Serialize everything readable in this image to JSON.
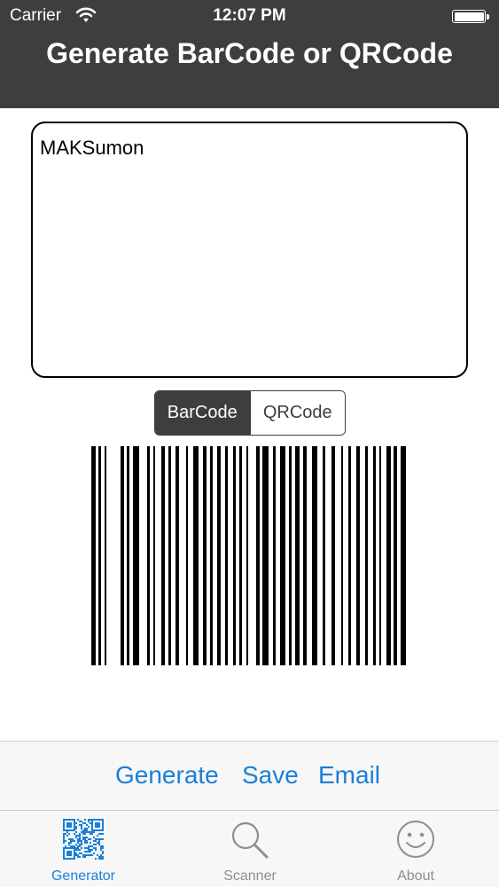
{
  "status_bar": {
    "carrier": "Carrier",
    "time": "12:07 PM"
  },
  "nav": {
    "title": "Generate BarCode or QRCode"
  },
  "input": {
    "value": "MAKSumon"
  },
  "segmented": {
    "barcode": "BarCode",
    "qrcode": "QRCode",
    "selected": "BarCode"
  },
  "toolbar": {
    "generate": "Generate",
    "save": "Save",
    "email": "Email"
  },
  "tabs": [
    {
      "label": "Generator",
      "icon": "qr-code-icon",
      "active": true
    },
    {
      "label": "Scanner",
      "icon": "magnifier-icon",
      "active": false
    },
    {
      "label": "About",
      "icon": "smiley-icon",
      "active": false
    }
  ],
  "colors": {
    "header": "#3e3d40",
    "accent": "#1a7fd8",
    "inactive": "#8e8e93"
  }
}
